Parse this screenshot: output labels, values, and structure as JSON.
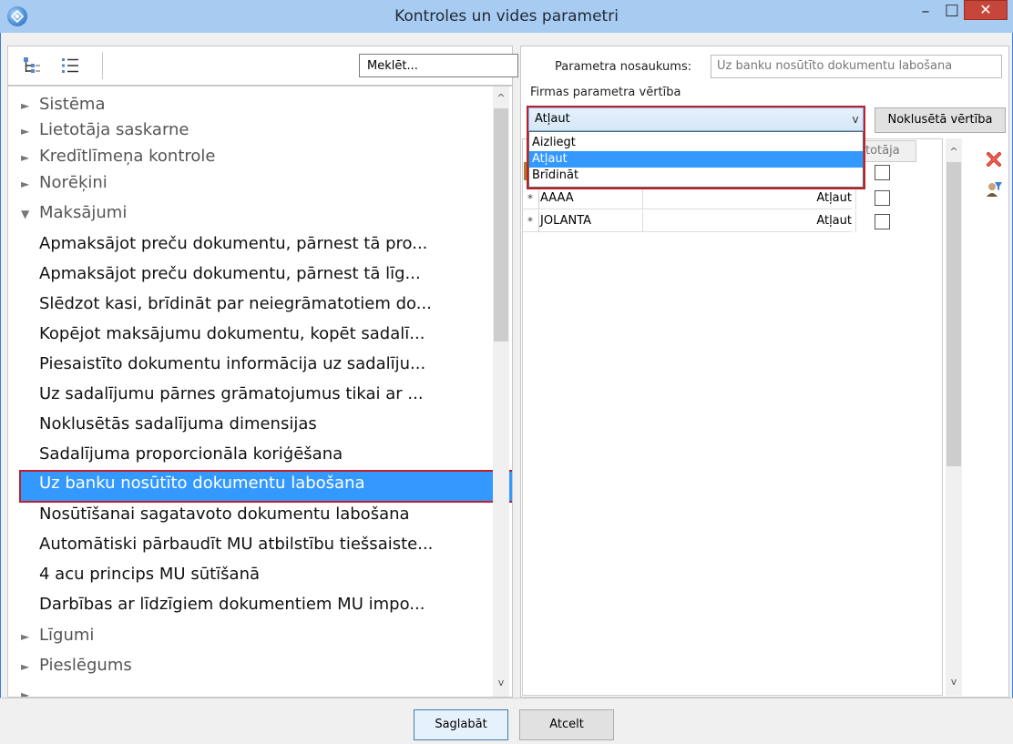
{
  "window": {
    "title": "Kontroles un vides parametri",
    "minimize_glyph": "–",
    "maximize_glyph": "☐",
    "close_glyph": "✕"
  },
  "left": {
    "search_value": "Meklēt...",
    "tree": [
      {
        "label": "Sistēma",
        "kind": "group",
        "expanded": false
      },
      {
        "label": "Lietotāja saskarne",
        "kind": "group",
        "expanded": false
      },
      {
        "label": "Kredītlīmeņa kontrole",
        "kind": "group",
        "expanded": false
      },
      {
        "label": "Norēķini",
        "kind": "group",
        "expanded": false
      },
      {
        "label": "Maksājumi",
        "kind": "group",
        "expanded": true
      },
      {
        "label": "Apmaksājot preču dokumentu, pārnest tā pro...",
        "kind": "leaf"
      },
      {
        "label": "Apmaksājot preču dokumentu, pārnest tā līg...",
        "kind": "leaf"
      },
      {
        "label": "Slēdzot kasi, brīdināt par neiegrāmatotiem do...",
        "kind": "leaf"
      },
      {
        "label": "Kopējot maksājumu dokumentu, kopēt sadalī...",
        "kind": "leaf"
      },
      {
        "label": "Piesaistīto dokumentu informācija uz sadalīju...",
        "kind": "leaf"
      },
      {
        "label": "Uz sadalījumu pārnes grāmatojumus tikai ar ...",
        "kind": "leaf"
      },
      {
        "label": "Noklusētās sadalījuma dimensijas",
        "kind": "leaf"
      },
      {
        "label": "Sadalījuma proporcionāla koriģēšana",
        "kind": "leaf"
      },
      {
        "label": "Uz banku nosūtīto dokumentu labošana",
        "kind": "leaf",
        "selected": true
      },
      {
        "label": "Nosūtīšanai sagatavoto dokumentu labošana",
        "kind": "leaf"
      },
      {
        "label": "Automātiski pārbaudīt MU atbilstību tiešsaiste...",
        "kind": "leaf"
      },
      {
        "label": "4 acu princips MU sūtīšanā",
        "kind": "leaf"
      },
      {
        "label": "Darbības ar līdzīgiem dokumentiem MU impo...",
        "kind": "leaf"
      },
      {
        "label": "Līgumi",
        "kind": "group",
        "expanded": false
      },
      {
        "label": "Pieslēgums",
        "kind": "group",
        "expanded": false
      }
    ]
  },
  "right": {
    "param_name_label": "Parametra nosaukums:",
    "param_name_value": "Uz banku nosūtīto dokumentu labošana",
    "company_value_label": "Firmas parametra vērtība",
    "combo_selected": "Atļaut",
    "dropdown_options": [
      "Aizliegt",
      "Atļaut",
      "Brīdināt"
    ],
    "dropdown_highlight_index": 1,
    "default_button": "Noklusētā vērtība",
    "grid_header_partial": "ētotāja",
    "grid_rows": [
      {
        "marker": "*",
        "user": "AAAA",
        "value": "Atļaut"
      },
      {
        "marker": "*",
        "user": "JOLANTA",
        "value": "Atļaut"
      }
    ]
  },
  "footer": {
    "save": "Saglabāt",
    "cancel": "Atcelt"
  },
  "colors": {
    "selection": "#3399ff",
    "highlight_border": "#c0202a",
    "titlebar": "#a8cbf1",
    "close_button": "#c7463b"
  }
}
